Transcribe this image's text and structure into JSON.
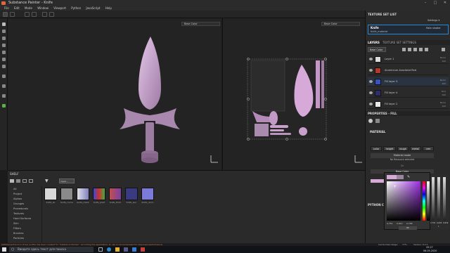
{
  "window": {
    "title": "Substance Painter - Knife",
    "minimize": "–",
    "maximize": "□",
    "close": "✕"
  },
  "menu": [
    "File",
    "Edit",
    "Mode",
    "Window",
    "Viewport",
    "Python",
    "JavaScript",
    "Help"
  ],
  "viewport3d": {
    "channel_select": "Base Color"
  },
  "viewport2d": {
    "channel_select": "Base Color"
  },
  "shelf": {
    "title": "SHELF",
    "search_value": "input...",
    "categories": [
      "All",
      "Project",
      "Alphas",
      "Grunges",
      "Procedurals",
      "Textures",
      "Hard Surfaces",
      "Skin",
      "Filters",
      "Brushes",
      "Particles"
    ],
    "thumbs": [
      {
        "label": "Knife_ao",
        "color": "#d8d8d8"
      },
      {
        "label": "Knife_curva",
        "color": "#8a8a8a"
      },
      {
        "label": "Knife_mask",
        "color": "#c8c8d0"
      },
      {
        "label": "Knife_posit",
        "color": "#c03030"
      },
      {
        "label": "Knife_thick",
        "color": "#7a3fa0"
      },
      {
        "label": "Knife_wor",
        "color": "#3a3a80"
      },
      {
        "label": "Knife_norm",
        "color": "#7c7cd8"
      }
    ]
  },
  "texture_set_list": {
    "title": "TEXTURE SET LIST",
    "settings_label": "Settings ▾",
    "set_name": "Knife",
    "material_name": "Knife_material",
    "shader": "Main shader"
  },
  "layers": {
    "tab_layers": "LAYERS",
    "tab_tss": "TEXTURE SET SETTINGS",
    "channel": "Base Color",
    "items": [
      {
        "name": "Layer 1",
        "blend": "Norm",
        "value": "100",
        "color": "#dcdcdc"
      },
      {
        "name": "Aluminium Anodized Red",
        "blend": "",
        "value": "",
        "color": "#b33a2a"
      },
      {
        "name": "Fill layer 3",
        "blend": "Norm",
        "value": "100",
        "color": "#3a52c0"
      },
      {
        "name": "Fill layer 4",
        "blend": "Ovrl",
        "value": "100",
        "color": "#2e2e6a"
      },
      {
        "name": "Fill layer 2",
        "blend": "Norm",
        "value": "100",
        "color": "#e8e8e8"
      }
    ]
  },
  "properties": {
    "title": "PROPERTIES - FILL",
    "material_label": "MATERIAL",
    "buttons": [
      "color",
      "height",
      "rough",
      "metal",
      "nrm"
    ],
    "material_mode": "Material mode",
    "no_resource": "No Resource selected",
    "or_label": "Or",
    "base_color": "Base Color",
    "uniform_color": "uniform color",
    "python_console": "PYTHON CON",
    "dynamic_label": "dynamic"
  },
  "color_picker": {
    "values": [
      "0,751",
      "0,612",
      "0,796"
    ],
    "values2": [
      "0,791",
      "0,695",
      "0,839"
    ],
    "alpha": "1",
    "ok_label": "Ok"
  },
  "status": {
    "left": "[GPUIssueCheck] A driver profile has been created for 'Substance Painter'. According the application, to use is recommended for improved performance.",
    "cache": "Cache Disk Usage:",
    "cache_value": "77%",
    "version": "Version: 6.2.1"
  },
  "taskbar": {
    "search_placeholder": "Введите здесь текст для поиска",
    "time": "20:27",
    "date": "06.05.2020"
  },
  "colors": {
    "accent": "#2e87cc",
    "uv": "#d7a9d9",
    "warning": "#e07a3a"
  }
}
